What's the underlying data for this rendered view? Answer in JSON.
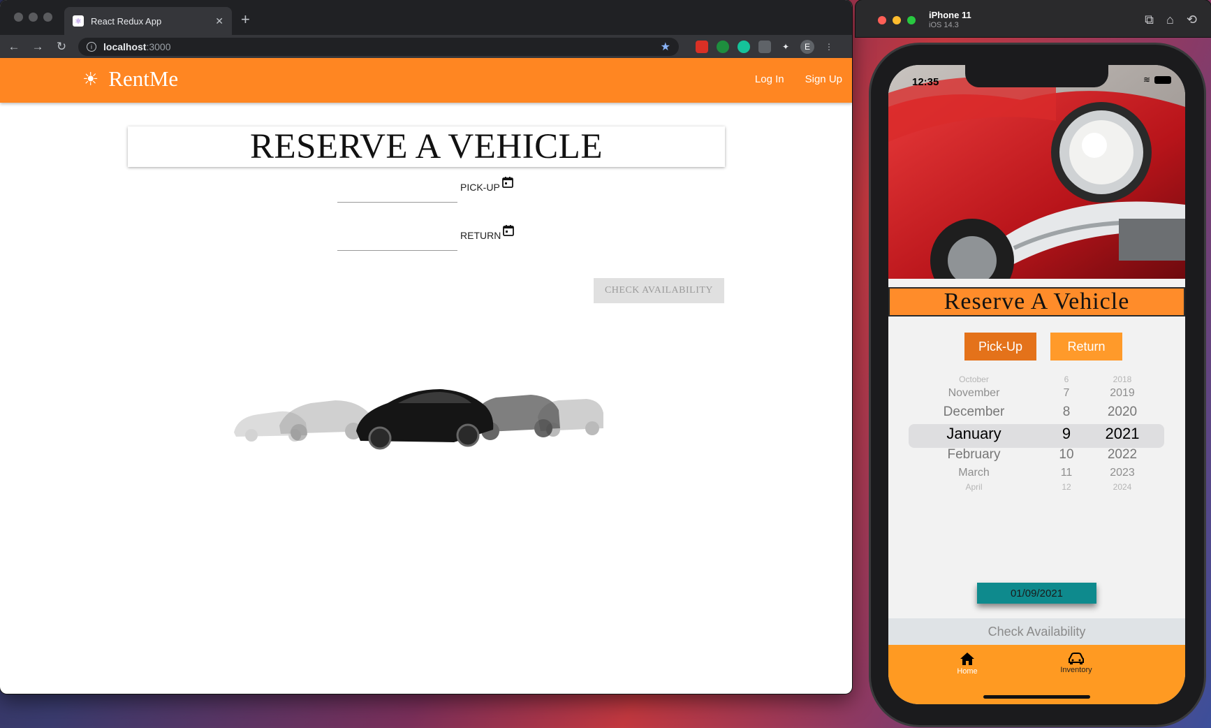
{
  "browser": {
    "tab_title": "React Redux App",
    "url_host": "localhost",
    "url_port": ":3000",
    "profile_initial": "E"
  },
  "app": {
    "brand": "RentMe",
    "nav": {
      "login": "Log In",
      "signup": "Sign Up"
    },
    "title": "RESERVE A VEHICLE",
    "pickup_label": "PICK-UP",
    "return_label": "RETURN",
    "check_button": "CHECK AVAILABILITY",
    "colors": {
      "accent": "#ff8622",
      "button_disabled": "#e0e0e0"
    }
  },
  "simulator": {
    "device": "iPhone 11",
    "os": "iOS 14.3"
  },
  "mobile": {
    "time": "12:35",
    "title": "Reserve A Vehicle",
    "pickup_button": "Pick-Up",
    "return_button": "Return",
    "picker": {
      "months": [
        "October",
        "November",
        "December",
        "January",
        "February",
        "March",
        "April"
      ],
      "days": [
        "6",
        "7",
        "8",
        "9",
        "10",
        "11",
        "12"
      ],
      "years": [
        "2018",
        "2019",
        "2020",
        "2021",
        "2022",
        "2023",
        "2024"
      ],
      "selected_index": 3
    },
    "date_value": "01/09/2021",
    "check_button": "Check Availability",
    "tabs": {
      "home": "Home",
      "inventory": "Inventory"
    },
    "colors": {
      "accent": "#ff9a22",
      "date_button": "#0e8a8d",
      "pickup_active": "#e4721a"
    }
  }
}
